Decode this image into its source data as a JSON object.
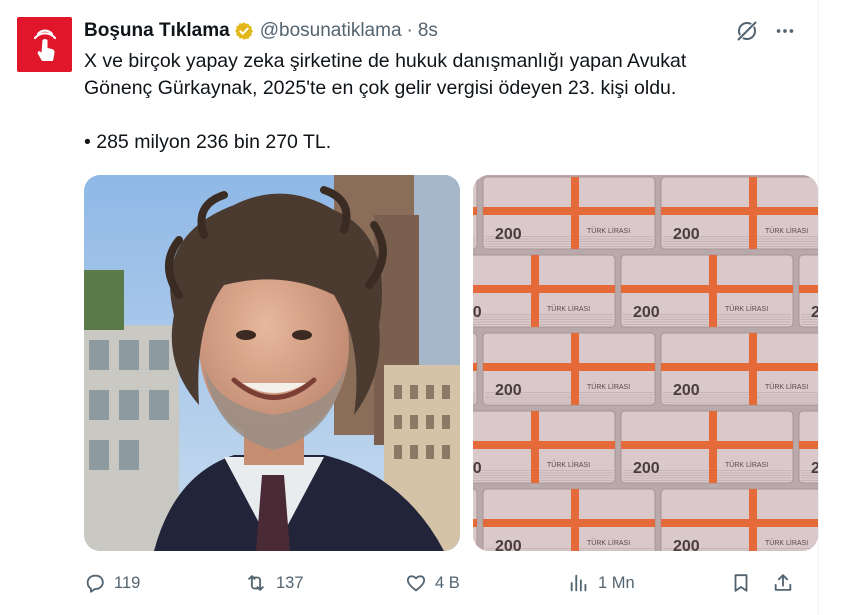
{
  "author": {
    "display_name": "Boşuna Tıklama",
    "handle": "@bosunatiklama",
    "separator": "·",
    "time": "8s",
    "verified": true,
    "avatar_color": "#e0172b",
    "avatar_icon": "hand-pointer-icon"
  },
  "tweet": {
    "line1": "X ve birçok yapay zeka şirketine de hukuk danışmanlığı yapan Avukat",
    "line2": "Gönenç Gürkaynak, 2025'te en çok gelir vergisi ödeyen 23. kişi oldu.",
    "amount": "• 285 milyon 236 bin 270 TL."
  },
  "media": {
    "photo_left_icon": "portrait-photo",
    "photo_right_icon": "banknote-stacks-photo",
    "banknote_label": "200",
    "banknote_text": "TÜRK LİRASI"
  },
  "actions": {
    "replies": "119",
    "reposts": "137",
    "likes": "4 B",
    "views": "1 Mn"
  },
  "colors": {
    "text": "#0f1419",
    "muted": "#536471",
    "verified_gold": "#e2b719",
    "banknote_pink": "#d9c9cb",
    "band_orange": "#e56a3a"
  }
}
